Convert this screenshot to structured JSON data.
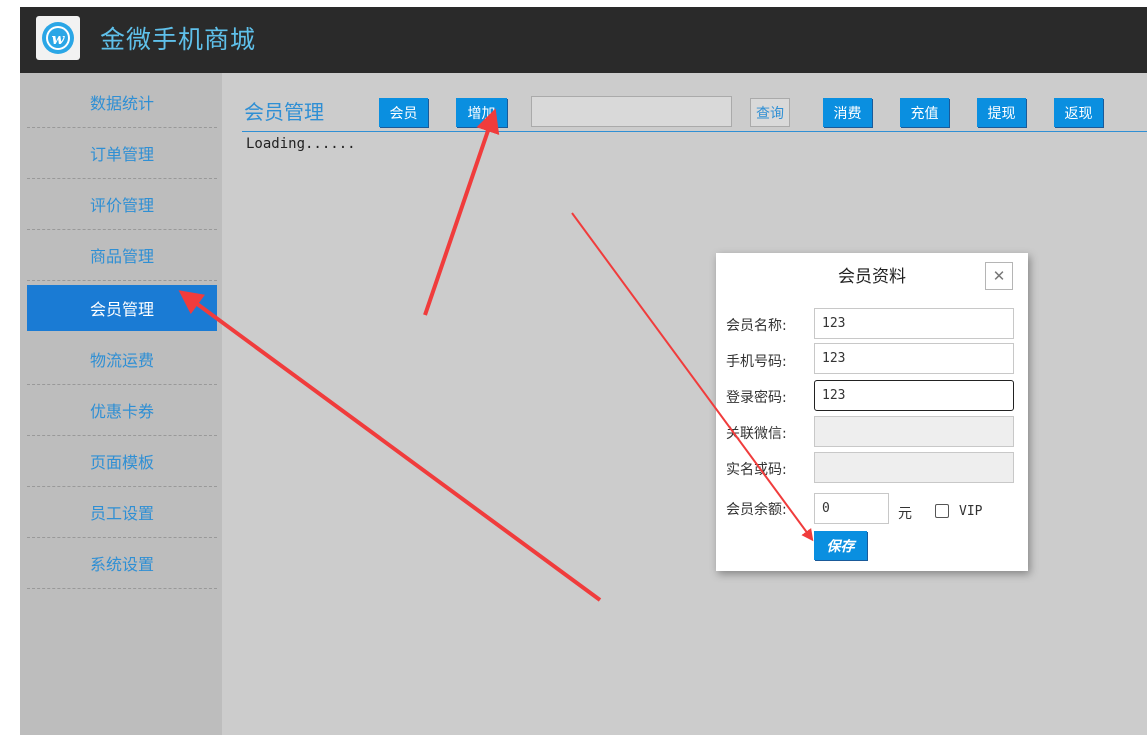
{
  "header": {
    "title": "金微手机商城",
    "logo_icon": "w-logo-icon"
  },
  "sidebar": {
    "items": [
      {
        "label": "数据统计",
        "active": false
      },
      {
        "label": "订单管理",
        "active": false
      },
      {
        "label": "评价管理",
        "active": false
      },
      {
        "label": "商品管理",
        "active": false
      },
      {
        "label": "会员管理",
        "active": true
      },
      {
        "label": "物流运费",
        "active": false
      },
      {
        "label": "优惠卡券",
        "active": false
      },
      {
        "label": "页面模板",
        "active": false
      },
      {
        "label": "员工设置",
        "active": false
      },
      {
        "label": "系统设置",
        "active": false
      }
    ]
  },
  "main": {
    "title": "会员管理",
    "toolbar": {
      "member": "会员",
      "add": "增加",
      "search_value": "",
      "query": "查询",
      "consume": "消费",
      "recharge": "充值",
      "withdraw": "提现",
      "cashback": "返现"
    },
    "loading_text": "Loading......"
  },
  "modal": {
    "title": "会员资料",
    "close_icon": "close-icon",
    "fields": {
      "name": {
        "label": "会员名称:",
        "value": "123"
      },
      "phone": {
        "label": "手机号码:",
        "value": "123"
      },
      "password": {
        "label": "登录密码:",
        "value": "123"
      },
      "wechat": {
        "label": "关联微信:",
        "value": ""
      },
      "realname": {
        "label": "实名或码:",
        "value": ""
      },
      "balance": {
        "label": "会员余额:",
        "value": "0",
        "unit": "元"
      }
    },
    "vip": {
      "label": "VIP",
      "checked": false
    },
    "save": "保存"
  },
  "colors": {
    "accent": "#0a8fe0",
    "topbar": "#2a2a2a",
    "title_blue": "#5fc0ea",
    "annotation_red": "#f03c3c"
  }
}
